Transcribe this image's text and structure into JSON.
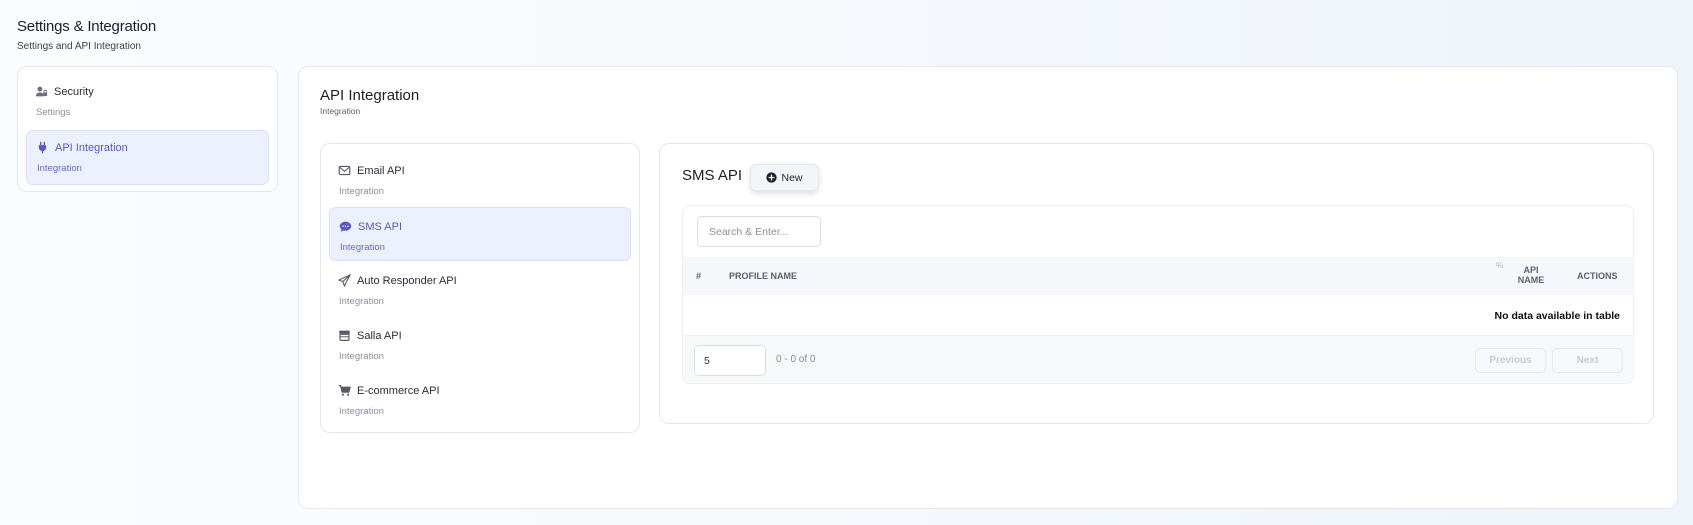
{
  "header": {
    "title": "Settings & Integration",
    "subtitle": "Settings and API Integration"
  },
  "sidebar": {
    "items": [
      {
        "label": "Security",
        "sub": "Settings",
        "icon": "user-lock-icon",
        "active": false
      },
      {
        "label": "API Integration",
        "sub": "Integration",
        "icon": "plug-icon",
        "active": true
      }
    ]
  },
  "main": {
    "title": "API Integration",
    "subtitle": "Integration",
    "api_list": [
      {
        "label": "Email API",
        "sub": "Integration",
        "icon": "envelope-icon"
      },
      {
        "label": "SMS API",
        "sub": "Integration",
        "icon": "sms-icon",
        "active": true
      },
      {
        "label": "Auto Responder API",
        "sub": "Integration",
        "icon": "paper-plane-icon"
      },
      {
        "label": "Salla API",
        "sub": "Integration",
        "icon": "store-icon"
      },
      {
        "label": "E-commerce API",
        "sub": "Integration",
        "icon": "cart-icon"
      }
    ],
    "sms": {
      "title": "SMS API",
      "new_label": "New",
      "search_placeholder": "Search & Enter...",
      "columns": {
        "hash": "#",
        "profile": "PROFILE NAME",
        "sort": "%",
        "api": "API NAME",
        "actions": "ACTIONS"
      },
      "empty_text": "No data available in table",
      "page_size": "5",
      "range": "0 - 0 of 0",
      "prev_label": "Previous",
      "next_label": "Next"
    }
  },
  "colors": {
    "accent": "#5b57c7",
    "active_bg": "#edf1fd"
  }
}
